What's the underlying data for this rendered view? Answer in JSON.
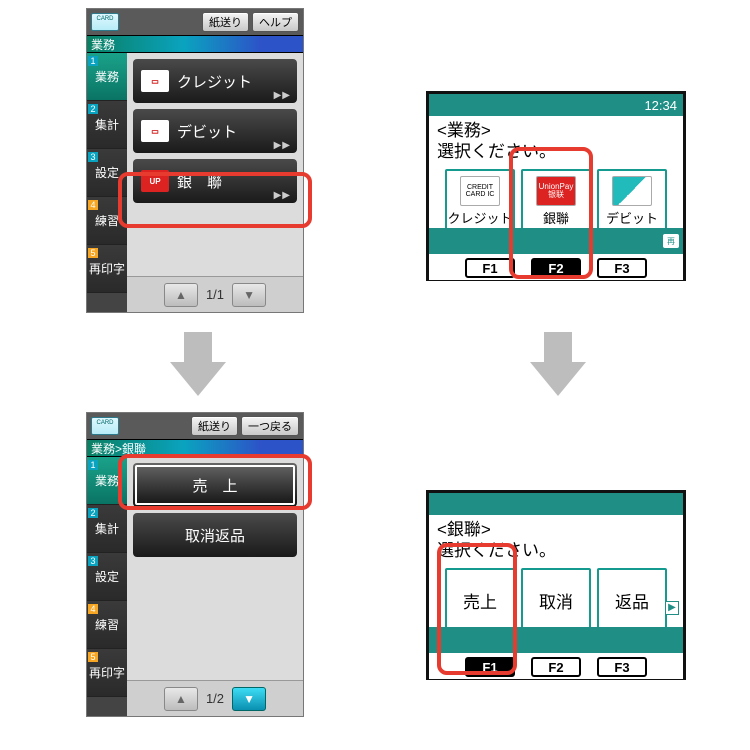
{
  "left_terminals": {
    "top": {
      "toolbar": {
        "btn1": "紙送り",
        "btn2": "ヘルプ"
      },
      "breadcrumb": "業務",
      "side_tabs": [
        {
          "num": "1",
          "label": "業務",
          "variant": "teal",
          "active": true
        },
        {
          "num": "2",
          "label": "集計",
          "variant": "teal"
        },
        {
          "num": "3",
          "label": "設定",
          "variant": "teal"
        },
        {
          "num": "4",
          "label": "練習",
          "variant": "orange"
        },
        {
          "num": "5",
          "label": "再印字",
          "variant": "orange"
        }
      ],
      "rows": [
        {
          "icon": "credit-card-icon",
          "label": "クレジット",
          "more": true
        },
        {
          "icon": "debit-card-icon",
          "label": "デビット",
          "more": true
        },
        {
          "icon": "unionpay-icon",
          "label": "銀　聯",
          "more": true,
          "highlighted": true
        }
      ],
      "pager": {
        "prev_active": false,
        "next_active": false,
        "text": "1/1"
      }
    },
    "bottom": {
      "toolbar": {
        "btn1": "紙送り",
        "btn2": "一つ戻る"
      },
      "breadcrumb": "業務>銀聯",
      "side_tabs_same_as_top": true,
      "rows": [
        {
          "label": "売　上",
          "highlighted": true,
          "selected": true
        },
        {
          "label": "取消返品"
        }
      ],
      "pager": {
        "prev_active": false,
        "next_active": true,
        "text": "1/2"
      }
    }
  },
  "right_terminals": {
    "top": {
      "clock": "12:34",
      "title_line1": "<業務>",
      "title_line2": "選択ください。",
      "options": [
        {
          "id": "credit",
          "caption": "クレジット",
          "icon_text": "CREDIT CARD\nIC"
        },
        {
          "id": "unionpay",
          "caption": "銀聯",
          "icon_text": "UnionPay\n银联",
          "highlighted": true
        },
        {
          "id": "debit",
          "caption": "デビット",
          "icon_text": ""
        }
      ],
      "footer_chip": "再",
      "fkeys": [
        {
          "label": "F1",
          "active": false
        },
        {
          "label": "F2",
          "active": true
        },
        {
          "label": "F3",
          "active": false
        }
      ]
    },
    "bottom": {
      "title_line1": "<銀聯>",
      "title_line2": "選択ください。",
      "options": [
        {
          "caption": "売上",
          "highlighted": true
        },
        {
          "caption": "取消"
        },
        {
          "caption": "返品"
        }
      ],
      "scroll_icon": "▶",
      "fkeys": [
        {
          "label": "F1",
          "active": true
        },
        {
          "label": "F2",
          "active": false
        },
        {
          "label": "F3",
          "active": false
        }
      ]
    }
  },
  "arrow_glyph": "⬇"
}
